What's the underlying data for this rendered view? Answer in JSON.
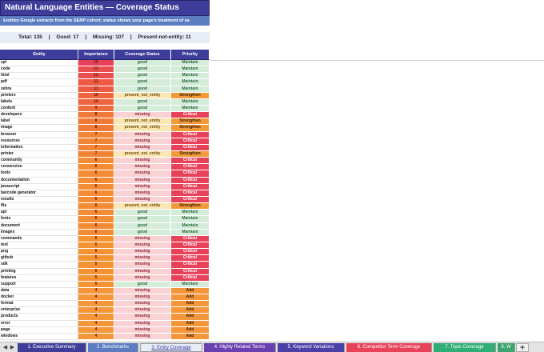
{
  "sheet": {
    "title": "Natural Language Entities — Coverage Status",
    "subtitle": "Entities Google extracts from the SERP cohort; status shows your page's treatment of ea",
    "summary": {
      "total": "Total: 135",
      "good": "Good: 17",
      "missing": "Missing: 107",
      "pne": "Present-not-entity: 11",
      "sep": "|"
    },
    "columns": [
      "Entity",
      "Importance",
      "Coverage Status",
      "Priority"
    ],
    "rows": [
      [
        "zpl",
        "15",
        "good",
        "Maintain"
      ],
      [
        "code",
        "12",
        "good",
        "Maintain"
      ],
      [
        "html",
        "12",
        "good",
        "Maintain"
      ],
      [
        "pdf",
        "11",
        "good",
        "Maintain"
      ],
      [
        "zebra",
        "11",
        "good",
        "Maintain"
      ],
      [
        "printers",
        "10",
        "present_not_entity",
        "Strengthen"
      ],
      [
        "labels",
        "10",
        "good",
        "Maintain"
      ],
      [
        "content",
        "9",
        "good",
        "Maintain"
      ],
      [
        "developers",
        "8",
        "missing",
        "Critical"
      ],
      [
        "label",
        "8",
        "present_not_entity",
        "Strengthen"
      ],
      [
        "image",
        "8",
        "present_not_entity",
        "Strengthen"
      ],
      [
        "browser",
        "7",
        "missing",
        "Critical"
      ],
      [
        "resources",
        "7",
        "missing",
        "Critical"
      ],
      [
        "information",
        "7",
        "missing",
        "Critical"
      ],
      [
        "printer",
        "7",
        "present_not_entity",
        "Strengthen"
      ],
      [
        "community",
        "6",
        "missing",
        "Critical"
      ],
      [
        "conversion",
        "6",
        "missing",
        "Critical"
      ],
      [
        "tools",
        "6",
        "missing",
        "Critical"
      ],
      [
        "documentation",
        "6",
        "missing",
        "Critical"
      ],
      [
        "javascript",
        "6",
        "missing",
        "Critical"
      ],
      [
        "barcode generator",
        "6",
        "missing",
        "Critical"
      ],
      [
        "results",
        "6",
        "missing",
        "Critical"
      ],
      [
        "file",
        "6",
        "present_not_entity",
        "Strengthen"
      ],
      [
        "api",
        "6",
        "good",
        "Maintain"
      ],
      [
        "fonts",
        "6",
        "good",
        "Maintain"
      ],
      [
        "document",
        "6",
        "good",
        "Maintain"
      ],
      [
        "images",
        "6",
        "good",
        "Maintain"
      ],
      [
        "commands",
        "5",
        "missing",
        "Critical"
      ],
      [
        "text",
        "5",
        "missing",
        "Critical"
      ],
      [
        "png",
        "5",
        "missing",
        "Critical"
      ],
      [
        "github",
        "5",
        "missing",
        "Critical"
      ],
      [
        "sdk",
        "5",
        "missing",
        "Critical"
      ],
      [
        "printing",
        "5",
        "missing",
        "Critical"
      ],
      [
        "features",
        "5",
        "missing",
        "Critical"
      ],
      [
        "support",
        "5",
        "good",
        "Maintain"
      ],
      [
        "data",
        "4",
        "missing",
        "Add"
      ],
      [
        "docker",
        "4",
        "missing",
        "Add"
      ],
      [
        "format",
        "4",
        "missing",
        "Add"
      ],
      [
        "enterprise",
        "4",
        "missing",
        "Add"
      ],
      [
        "products",
        "4",
        "missing",
        "Add"
      ],
      [
        "error",
        "4",
        "missing",
        "Add"
      ],
      [
        "page",
        "4",
        "missing",
        "Add"
      ],
      [
        "windows",
        "4",
        "missing",
        "Add"
      ]
    ]
  },
  "importance_colors": {
    "15": "#e8415a",
    "12": "#ea4e4e",
    "11": "#ec5a45",
    "10": "#ee6640",
    "9": "#ef6f3c",
    "8": "#f07a38",
    "7": "#f28436",
    "6": "#f38c34",
    "5": "#f59333",
    "4": "#f6963a"
  },
  "tabs": {
    "nav_prev": "◀",
    "nav_next": "▶",
    "add": "+",
    "items": [
      {
        "label": "1. Executive Summary",
        "color": "#3f3d9a",
        "text": "#ffffff"
      },
      {
        "label": "2. Benchmarks",
        "color": "#5c7cc2",
        "text": "#ffffff"
      },
      {
        "label": "3. Entity Coverage",
        "color": "#e8ecf6",
        "text": "#3f3d9a"
      },
      {
        "label": "4. Highly Related Terms",
        "color": "#6a3fb0",
        "text": "#ffffff"
      },
      {
        "label": "5. Keyword Variations",
        "color": "#4b3fa8",
        "text": "#ffffff"
      },
      {
        "label": "6. Competitor Term Coverage",
        "color": "#e8415a",
        "text": "#ffffff"
      },
      {
        "label": "7. Topic Coverage",
        "color": "#2fae78",
        "text": "#ffffff"
      },
      {
        "label": "8. W",
        "color": "#3aa56c",
        "text": "#ffffff"
      }
    ]
  }
}
